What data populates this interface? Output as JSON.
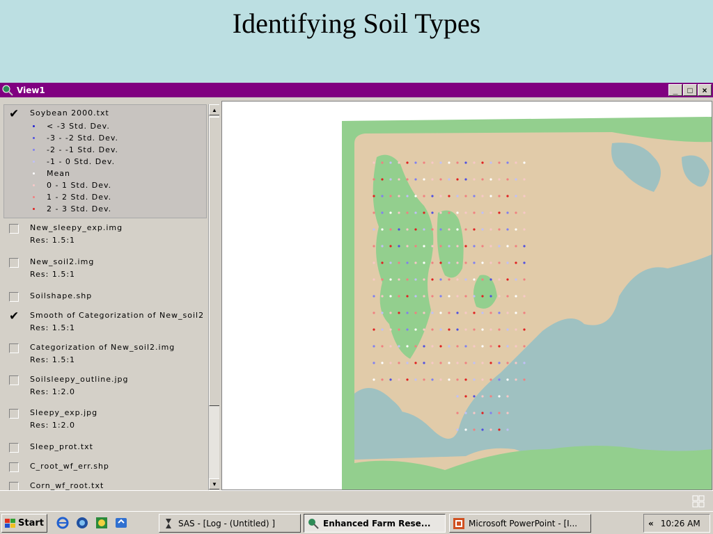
{
  "slide": {
    "title": "Identifying Soil Types"
  },
  "window": {
    "title": "View1",
    "minimize": "_",
    "maximize": "□",
    "close": "×"
  },
  "toc": {
    "layers": [
      {
        "name": "Soybean 2000.txt",
        "checked": true,
        "res": ""
      },
      {
        "name": "New_sleepy_exp.img",
        "checked": false,
        "res": "Res: 1.5:1"
      },
      {
        "name": "New_soil2.img",
        "checked": false,
        "res": "Res: 1.5:1"
      },
      {
        "name": "Soilshape.shp",
        "checked": false,
        "res": ""
      },
      {
        "name": "Smooth of Categorization of New_soil2",
        "checked": true,
        "res": "Res: 1.5:1"
      },
      {
        "name": "Categorization of New_soil2.img",
        "checked": false,
        "res": "Res: 1.5:1"
      },
      {
        "name": "Soilsleepy_outline.jpg",
        "checked": false,
        "res": "Res: 1:2.0"
      },
      {
        "name": "Sleepy_exp.jpg",
        "checked": false,
        "res": "Res: 1:2.0"
      },
      {
        "name": "Sleep_prot.txt",
        "checked": false,
        "res": ""
      },
      {
        "name": "C_root_wf_err.shp",
        "checked": false,
        "res": ""
      },
      {
        "name": "Corn_wf_root.txt",
        "checked": false,
        "res": ""
      }
    ],
    "check_glyph": "✔",
    "legend": [
      {
        "label": "< -3 Std. Dev.",
        "color": "#2020d0"
      },
      {
        "label": "-3 - -2 Std. Dev.",
        "color": "#5050e0"
      },
      {
        "label": "-2 - -1 Std. Dev.",
        "color": "#8080f0"
      },
      {
        "label": "-1 - 0 Std. Dev.",
        "color": "#c0c0f8"
      },
      {
        "label": "Mean",
        "color": "#ffffff"
      },
      {
        "label": "0 - 1 Std. Dev.",
        "color": "#f8c8c8"
      },
      {
        "label": "1 - 2 Std. Dev.",
        "color": "#f08080"
      },
      {
        "label": "2 - 3 Std. Dev.",
        "color": "#e02020"
      }
    ],
    "scroll_up": "▲",
    "scroll_down": "▼"
  },
  "map": {
    "colors": {
      "soil_tan": "#e1cba9",
      "soil_green": "#93cf8e",
      "soil_blue": "#9fc1c1",
      "background": "#ffffff"
    },
    "icon": "map-layer-icon"
  },
  "taskbar": {
    "start_label": "Start",
    "tasks": [
      {
        "label": "SAS - [Log - (Untitled) ]",
        "active": false
      },
      {
        "label": "Enhanced Farm Rese...",
        "active": true
      },
      {
        "label": "Microsoft PowerPoint - [I...",
        "active": false
      }
    ],
    "tray_arrow": "«",
    "clock": "10:26 AM"
  }
}
